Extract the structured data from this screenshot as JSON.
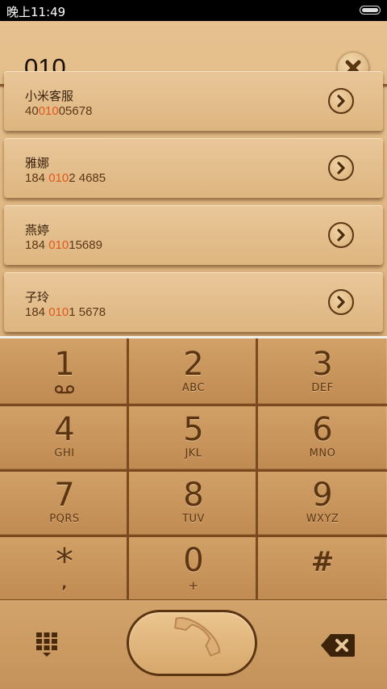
{
  "status_bar": {
    "time": "晚上11:49"
  },
  "input": {
    "value": "010"
  },
  "suggestions": [
    {
      "name": "小米客服",
      "number_prefix": "40",
      "number_match": "010",
      "number_suffix": "05678"
    },
    {
      "name": "雅娜",
      "number_prefix": "184 ",
      "number_match": "010",
      "number_suffix": "2 4685"
    },
    {
      "name": "燕婷",
      "number_prefix": "184 ",
      "number_match": "010",
      "number_suffix": "15689"
    },
    {
      "name": "子玲",
      "number_prefix": "184 ",
      "number_match": "010",
      "number_suffix": "1 5678"
    }
  ],
  "keypad": {
    "keys": [
      {
        "digit": "1",
        "letters": ""
      },
      {
        "digit": "2",
        "letters": "ABC"
      },
      {
        "digit": "3",
        "letters": "DEF"
      },
      {
        "digit": "4",
        "letters": "GHI"
      },
      {
        "digit": "5",
        "letters": "JKL"
      },
      {
        "digit": "6",
        "letters": "MNO"
      },
      {
        "digit": "7",
        "letters": "PQRS"
      },
      {
        "digit": "8",
        "letters": "TUV"
      },
      {
        "digit": "9",
        "letters": "WXYZ"
      },
      {
        "digit": "*",
        "letters": ","
      },
      {
        "digit": "0",
        "letters": "+"
      },
      {
        "digit": "#",
        "letters": ""
      }
    ]
  },
  "icons": {
    "clear": "close-icon",
    "suggestion_arrow": "chevron-right-icon",
    "voicemail": "voicemail-icon",
    "dialpad": "dialpad-icon",
    "call": "phone-icon",
    "backspace": "backspace-icon",
    "battery": "battery-icon"
  },
  "colors": {
    "highlight": "#e4581e",
    "wood_dark": "#5b3512",
    "card_bg": "#e6c18f"
  }
}
